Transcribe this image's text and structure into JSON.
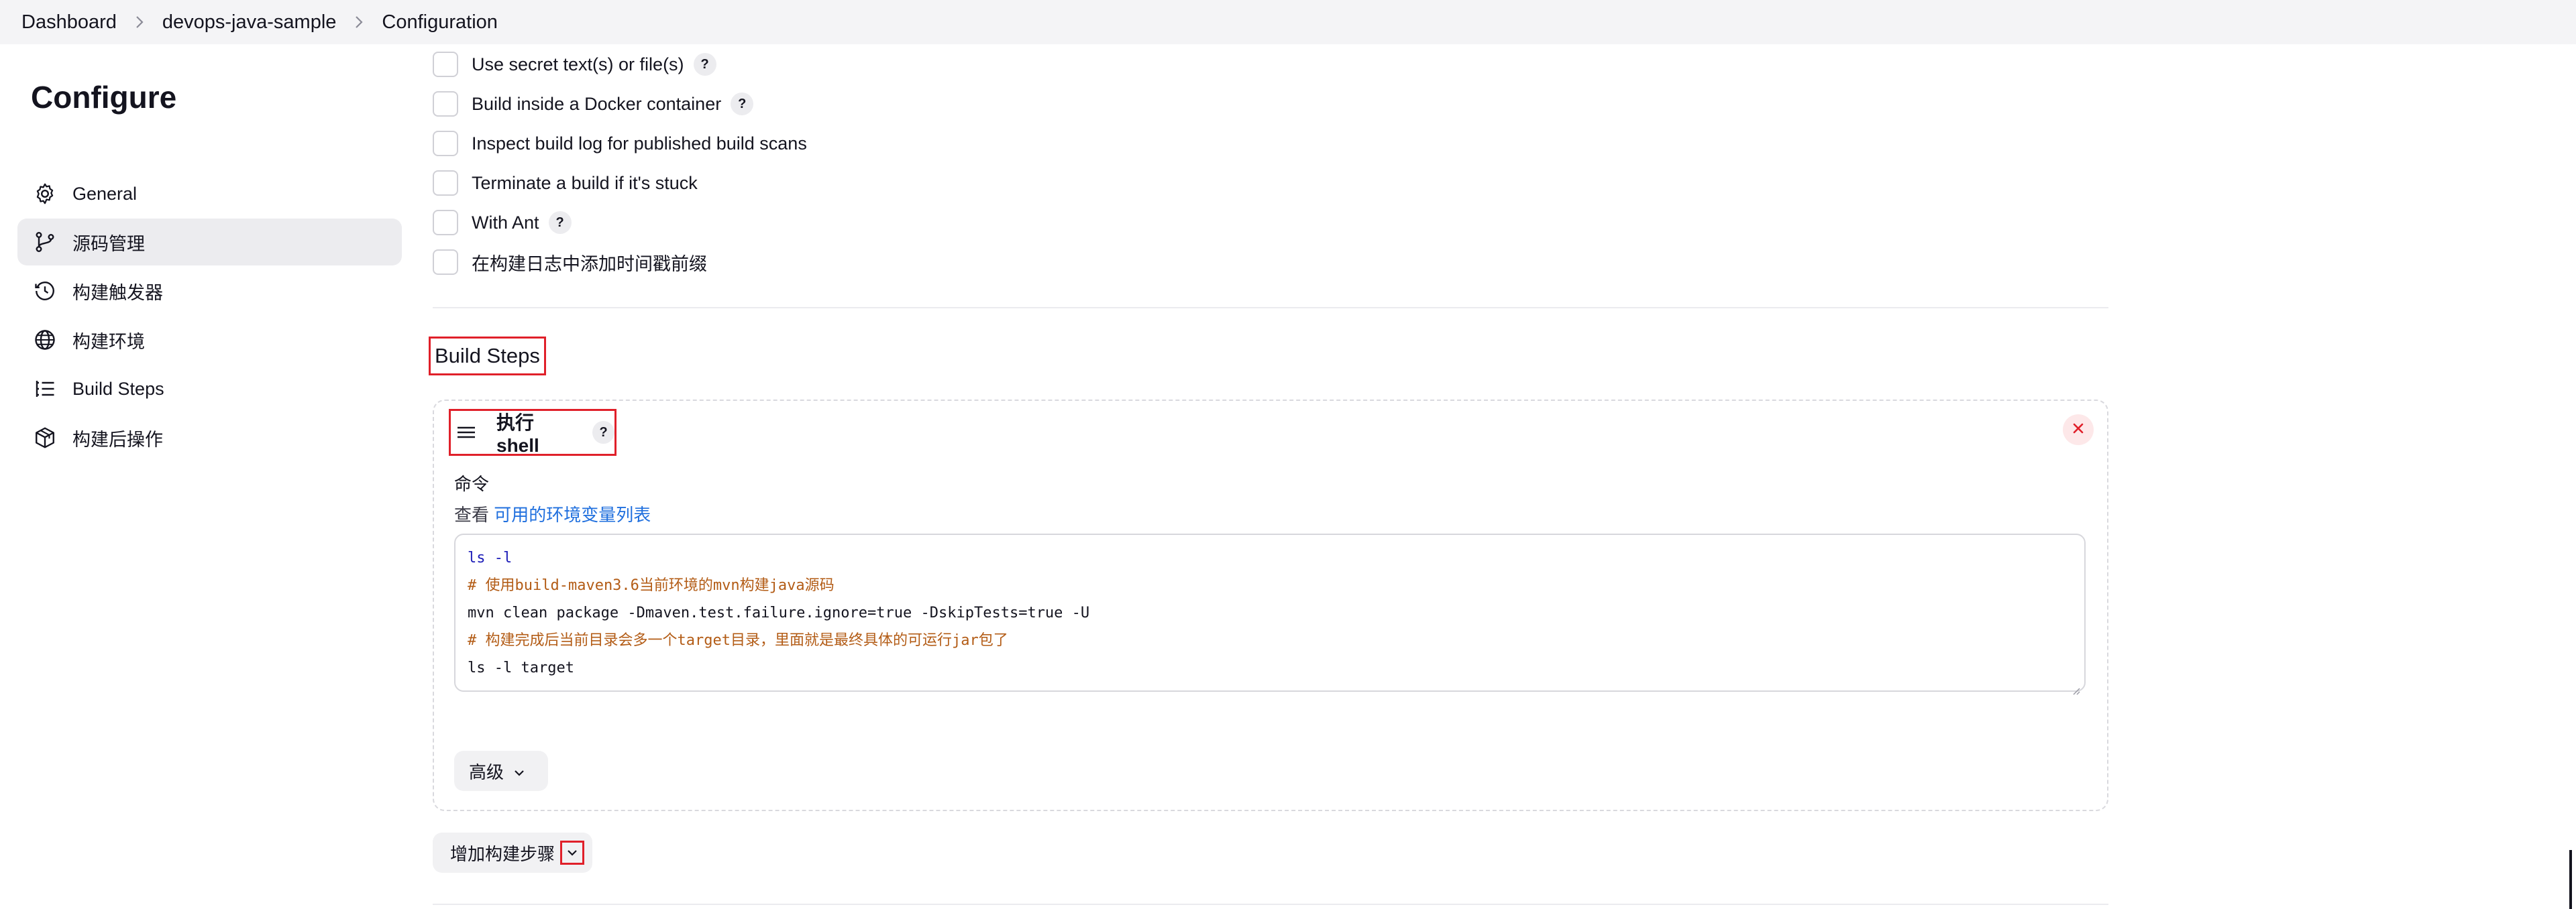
{
  "breadcrumb": {
    "items": [
      "Dashboard",
      "devops-java-sample",
      "Configuration"
    ]
  },
  "sidebar": {
    "title": "Configure",
    "items": [
      {
        "label": "General",
        "icon": "gear-icon",
        "active": false
      },
      {
        "label": "源码管理",
        "icon": "branch-icon",
        "active": true
      },
      {
        "label": "构建触发器",
        "icon": "clock-icon",
        "active": false
      },
      {
        "label": "构建环境",
        "icon": "globe-icon",
        "active": false
      },
      {
        "label": "Build Steps",
        "icon": "list-icon",
        "active": false
      },
      {
        "label": "构建后操作",
        "icon": "package-icon",
        "active": false
      }
    ]
  },
  "build_env": {
    "options": [
      {
        "label": "Use secret text(s) or file(s)",
        "help": "?",
        "checked": false
      },
      {
        "label": "Build inside a Docker container",
        "help": "?",
        "checked": false
      },
      {
        "label": "Inspect build log for published build scans",
        "checked": false
      },
      {
        "label": "Terminate a build if it's stuck",
        "checked": false
      },
      {
        "label": "With Ant",
        "help": "?",
        "checked": false
      },
      {
        "label": "在构建日志中添加时间戳前缀",
        "checked": false
      }
    ]
  },
  "build_steps": {
    "section_title": "Build Steps",
    "step_title": "执行 shell",
    "help": "?",
    "command_label": "命令",
    "env_prefix": "查看 ",
    "env_link": "可用的环境变量列表",
    "code_lines": [
      "ls -l",
      "# 使用build-maven3.6当前环境的mvn构建java源码",
      "mvn clean package -Dmaven.test.failure.ignore=true -DskipTests=true -U",
      "# 构建完成后当前目录会多一个target目录，里面就是最终具体的可运行jar包了",
      "ls -l target"
    ],
    "advanced_label": "高级",
    "add_step_label": "增加构建步骤"
  },
  "colors": {
    "highlight_border": "#e0202a",
    "link": "#1f6fde",
    "code_keyword": "#1c1cb8",
    "code_comment": "#b35c16"
  }
}
